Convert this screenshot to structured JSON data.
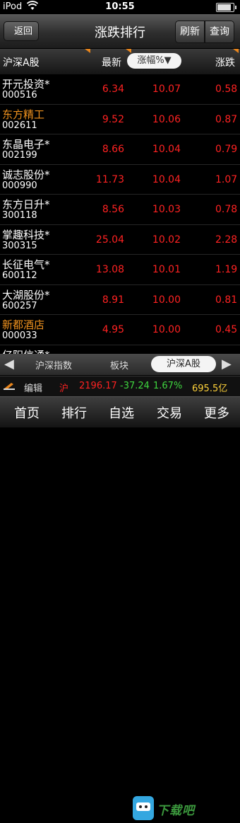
{
  "status": {
    "carrier": "iPod",
    "time": "10:55",
    "battery_level": 0.95
  },
  "nav": {
    "back": "返回",
    "title": "涨跌排行",
    "refresh": "刷新",
    "query": "查询"
  },
  "columns": {
    "market": "沪深A股",
    "latest": "最新",
    "pct": "涨幅%▼",
    "chg": "涨跌"
  },
  "rows": [
    {
      "name": "开元投资*",
      "code": "000516",
      "price": "6.34",
      "pct": "10.07",
      "chg": "0.58",
      "highlight": false
    },
    {
      "name": "东方精工",
      "code": "002611",
      "price": "9.52",
      "pct": "10.06",
      "chg": "0.87",
      "highlight": true
    },
    {
      "name": "东晶电子*",
      "code": "002199",
      "price": "8.66",
      "pct": "10.04",
      "chg": "0.79",
      "highlight": false
    },
    {
      "name": "诚志股份*",
      "code": "000990",
      "price": "11.73",
      "pct": "10.04",
      "chg": "1.07",
      "highlight": false
    },
    {
      "name": "东方日升*",
      "code": "300118",
      "price": "8.56",
      "pct": "10.03",
      "chg": "0.78",
      "highlight": false
    },
    {
      "name": "掌趣科技*",
      "code": "300315",
      "price": "25.04",
      "pct": "10.02",
      "chg": "2.28",
      "highlight": false
    },
    {
      "name": "长征电气*",
      "code": "600112",
      "price": "13.08",
      "pct": "10.01",
      "chg": "1.19",
      "highlight": false
    },
    {
      "name": "大湖股份*",
      "code": "600257",
      "price": "8.91",
      "pct": "10.00",
      "chg": "0.81",
      "highlight": false
    },
    {
      "name": "新都酒店",
      "code": "000033",
      "price": "4.95",
      "pct": "10.00",
      "chg": "0.45",
      "highlight": true
    },
    {
      "name": "亿阳信通*",
      "code": "",
      "price": "",
      "pct": "",
      "chg": "",
      "highlight": false
    }
  ],
  "tabs": {
    "left_arrow": "◀",
    "right_arrow": "▶",
    "items": [
      "沪深指数",
      "板块",
      "沪深A股"
    ],
    "active": 2
  },
  "ticker": {
    "edit": "编辑",
    "index": "沪",
    "value": "2196.17",
    "change": "-37.24",
    "change_pct": "1.67%",
    "amount": "695.5亿"
  },
  "bottom_nav": [
    "首页",
    "排行",
    "自选",
    "交易",
    "更多"
  ],
  "watermark": {
    "text": "下载吧"
  },
  "colors": {
    "up": "#ff2222",
    "down": "#3fd63f",
    "highlight": "#f0921e",
    "amount": "#ffd23a"
  }
}
